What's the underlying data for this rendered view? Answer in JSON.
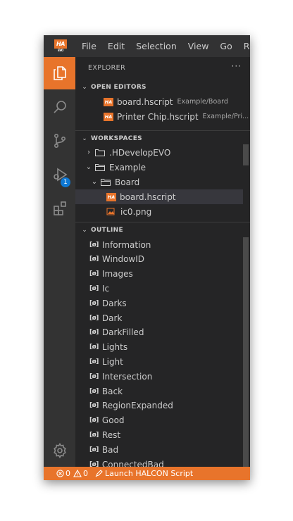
{
  "app": {
    "logo_text": "HA",
    "logo_subtext": "EVO",
    "menu": [
      "File",
      "Edit",
      "Selection",
      "View",
      "Go",
      "Run"
    ]
  },
  "activity_bar": {
    "items": [
      "explorer-icon",
      "search-icon",
      "source-control-icon",
      "run-debug-icon",
      "extensions-icon"
    ],
    "debug_badge": "1",
    "bottom_item": "gear-icon"
  },
  "explorer": {
    "title": "EXPLORER",
    "more": "···"
  },
  "open_editors": {
    "header": "OPEN EDITORS",
    "items": [
      {
        "name": "board.hscript",
        "path": "Example/Board"
      },
      {
        "name": "Printer Chip.hscript",
        "path": "Example/Pri..."
      }
    ]
  },
  "workspaces": {
    "header": "WORKSPACES",
    "tree": [
      {
        "label": ".HDevelopEVO",
        "chevron": "›"
      },
      {
        "label": "Example",
        "chevron": "⌄"
      },
      {
        "label": "Board",
        "chevron": "⌄"
      },
      {
        "label": "board.hscript"
      },
      {
        "label": "ic0.png"
      }
    ]
  },
  "outline": {
    "header": "OUTLINE",
    "symbol_glyph": "[ø]",
    "items": [
      "Information",
      "WindowID",
      "Images",
      "Ic",
      "Darks",
      "Dark",
      "DarkFilled",
      "Lights",
      "Light",
      "Intersection",
      "Back",
      "RegionExpanded",
      "Good",
      "Rest",
      "Bad",
      "ConnectedBad"
    ]
  },
  "status_bar": {
    "errors": "0",
    "warnings": "0",
    "launch": "Launch HALCON Script"
  },
  "colors": {
    "accent": "#e8742b",
    "sidebar_bg": "#252526",
    "activity_bg": "#333333",
    "titlebar_bg": "#323233",
    "badge": "#0e78d4"
  }
}
